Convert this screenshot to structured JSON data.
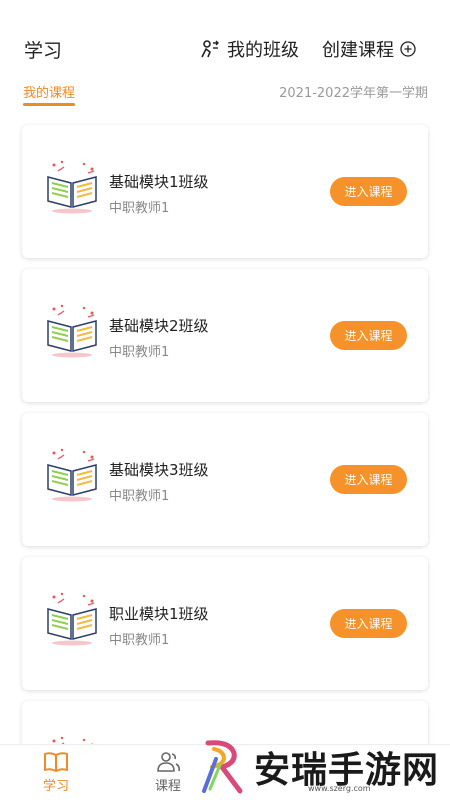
{
  "header": {
    "title": "学习",
    "my_class_label": "我的班级",
    "create_course_label": "创建课程"
  },
  "subbar": {
    "active_tab": "我的课程",
    "semester": "2021-2022学年第一学期"
  },
  "courses": [
    {
      "name": "基础模块1班级",
      "teacher": "中职教师1",
      "button": "进入课程"
    },
    {
      "name": "基础模块2班级",
      "teacher": "中职教师1",
      "button": "进入课程"
    },
    {
      "name": "基础模块3班级",
      "teacher": "中职教师1",
      "button": "进入课程"
    },
    {
      "name": "职业模块1班级",
      "teacher": "中职教师1",
      "button": "进入课程"
    }
  ],
  "tabbar": {
    "items": [
      {
        "label": "学习",
        "icon": "open-book-icon",
        "active": true
      },
      {
        "label": "课程",
        "icon": "people-icon",
        "active": false
      }
    ]
  },
  "watermark": {
    "text": "安瑞手游网",
    "url": "www.szerg.com"
  },
  "colors": {
    "accent": "#f08a24",
    "button": "#f7922b",
    "muted": "#999999"
  }
}
